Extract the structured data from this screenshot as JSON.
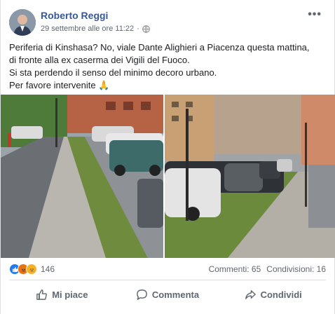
{
  "post": {
    "author": "Roberto Reggi",
    "timestamp": "29 settembre alle ore 11:22",
    "privacy_icon": "globe-icon",
    "more_label": "•••",
    "text_lines": [
      "Periferia di Kinshasa? No, viale Dante Alighieri a Piacenza questa mattina,",
      "di fronte alla ex caserma dei Vigili del Fuoco.",
      "Si sta perdendo il senso del minimo decoro urbano.",
      "Per favore intervenite"
    ],
    "pray_emoji": "🙏"
  },
  "reactions": {
    "icons": [
      "like-reaction-icon",
      "angry-reaction-icon",
      "sad-reaction-icon"
    ],
    "count": "146"
  },
  "stats": {
    "comments": "Commenti: 65",
    "shares": "Condivisioni: 16"
  },
  "actions": {
    "like": "Mi piace",
    "comment": "Commenta",
    "share": "Condividi"
  },
  "colors": {
    "link": "#385898",
    "like_blue": "#2078f4",
    "text": "#1c1e21",
    "secondary": "#606770"
  }
}
